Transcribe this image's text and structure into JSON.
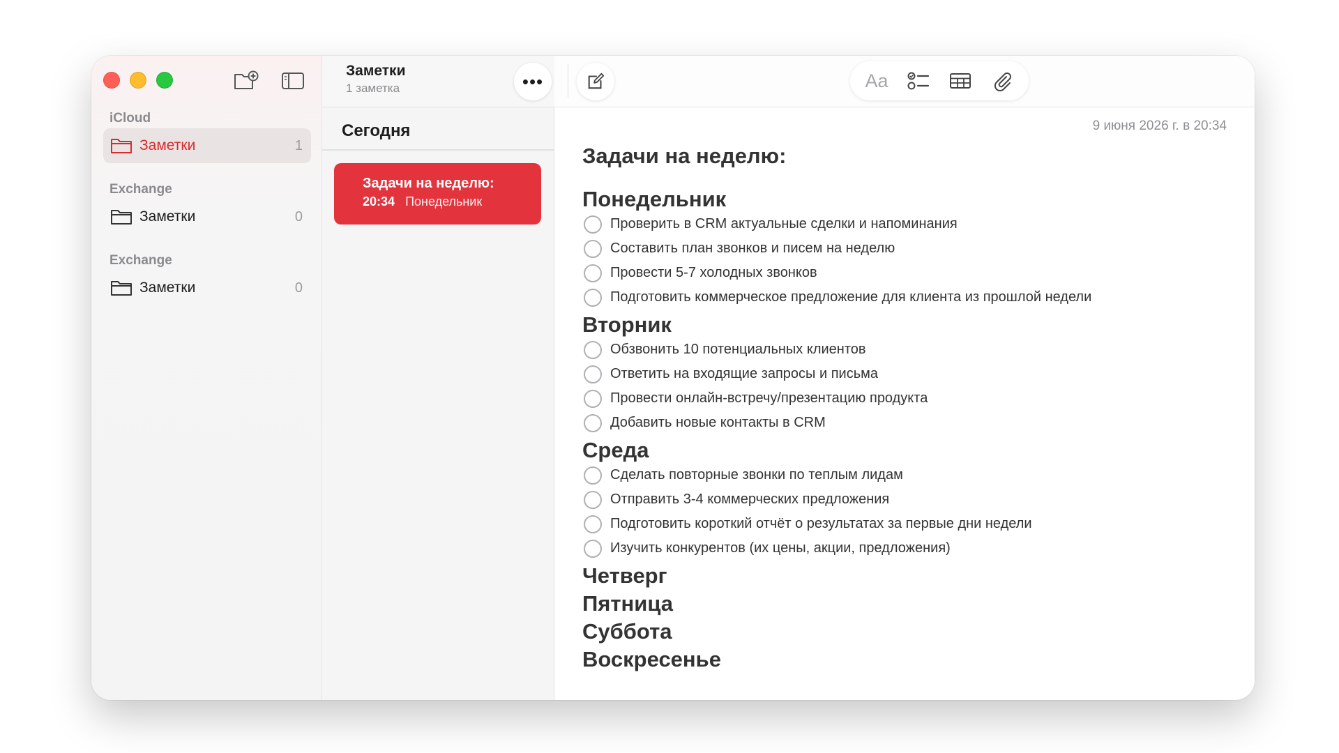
{
  "sidebar": {
    "sections": [
      {
        "title": "iCloud",
        "folder": {
          "label": "Заметки",
          "count": "1"
        }
      },
      {
        "title": "Exchange",
        "folder": {
          "label": "Заметки",
          "count": "0"
        }
      },
      {
        "title": "Exchange",
        "folder": {
          "label": "Заметки",
          "count": "0"
        }
      }
    ]
  },
  "list": {
    "title": "Заметки",
    "subtitle": "1 заметка",
    "more_label": "•••",
    "section": "Сегодня",
    "note": {
      "title": "Задачи на неделю:",
      "time": "20:34",
      "preview": "Понедельник"
    }
  },
  "toolbar": {
    "format_label": "Aa"
  },
  "note": {
    "date": "9 июня 2026 г. в 20:34",
    "title": "Задачи на неделю:",
    "days": [
      {
        "name": "Понедельник",
        "tasks": [
          "Проверить в CRM актуальные сделки и напоминания",
          "Составить план звонков и писем на неделю",
          "Провести 5-7 холодных звонков",
          "Подготовить коммерческое предложение для клиента из прошлой недели"
        ]
      },
      {
        "name": "Вторник",
        "tasks": [
          "Обзвонить 10 потенциальных клиентов",
          "Ответить на входящие запросы и письма",
          "Провести онлайн-встречу/презентацию продукта",
          "Добавить новые контакты в CRM"
        ]
      },
      {
        "name": "Среда",
        "tasks": [
          "Сделать повторные звонки по теплым лидам",
          "Отправить 3-4 коммерческих предложения",
          "Подготовить короткий отчёт о результатах за первые дни недели",
          "Изучить конкурентов (их цены, акции, предложения)"
        ]
      },
      {
        "name": "Четверг",
        "tasks": []
      },
      {
        "name": "Пятница",
        "tasks": []
      },
      {
        "name": "Суббота",
        "tasks": []
      },
      {
        "name": "Воскресенье",
        "tasks": []
      }
    ]
  }
}
